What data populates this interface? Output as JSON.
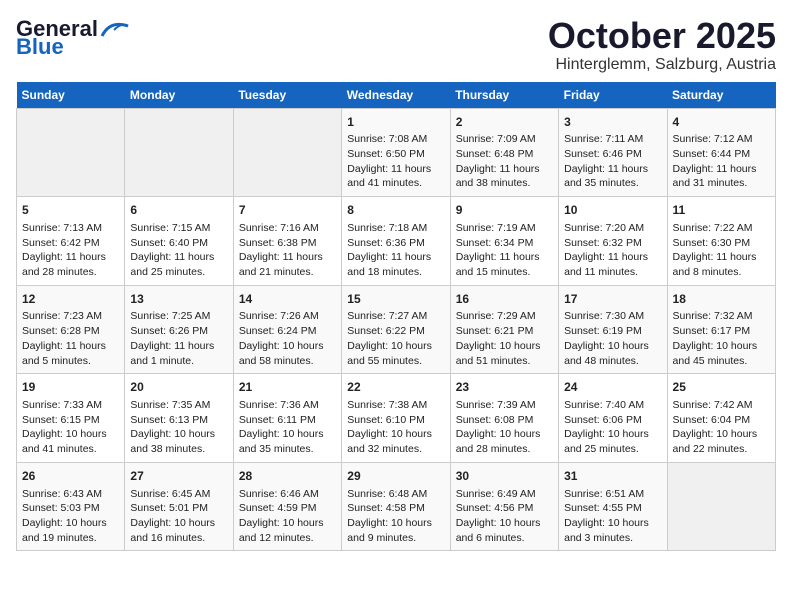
{
  "header": {
    "logo_general": "General",
    "logo_blue": "Blue",
    "month": "October 2025",
    "location": "Hinterglemm, Salzburg, Austria"
  },
  "weekdays": [
    "Sunday",
    "Monday",
    "Tuesday",
    "Wednesday",
    "Thursday",
    "Friday",
    "Saturday"
  ],
  "weeks": [
    [
      {
        "day": "",
        "info": ""
      },
      {
        "day": "",
        "info": ""
      },
      {
        "day": "",
        "info": ""
      },
      {
        "day": "1",
        "info": "Sunrise: 7:08 AM\nSunset: 6:50 PM\nDaylight: 11 hours\nand 41 minutes."
      },
      {
        "day": "2",
        "info": "Sunrise: 7:09 AM\nSunset: 6:48 PM\nDaylight: 11 hours\nand 38 minutes."
      },
      {
        "day": "3",
        "info": "Sunrise: 7:11 AM\nSunset: 6:46 PM\nDaylight: 11 hours\nand 35 minutes."
      },
      {
        "day": "4",
        "info": "Sunrise: 7:12 AM\nSunset: 6:44 PM\nDaylight: 11 hours\nand 31 minutes."
      }
    ],
    [
      {
        "day": "5",
        "info": "Sunrise: 7:13 AM\nSunset: 6:42 PM\nDaylight: 11 hours\nand 28 minutes."
      },
      {
        "day": "6",
        "info": "Sunrise: 7:15 AM\nSunset: 6:40 PM\nDaylight: 11 hours\nand 25 minutes."
      },
      {
        "day": "7",
        "info": "Sunrise: 7:16 AM\nSunset: 6:38 PM\nDaylight: 11 hours\nand 21 minutes."
      },
      {
        "day": "8",
        "info": "Sunrise: 7:18 AM\nSunset: 6:36 PM\nDaylight: 11 hours\nand 18 minutes."
      },
      {
        "day": "9",
        "info": "Sunrise: 7:19 AM\nSunset: 6:34 PM\nDaylight: 11 hours\nand 15 minutes."
      },
      {
        "day": "10",
        "info": "Sunrise: 7:20 AM\nSunset: 6:32 PM\nDaylight: 11 hours\nand 11 minutes."
      },
      {
        "day": "11",
        "info": "Sunrise: 7:22 AM\nSunset: 6:30 PM\nDaylight: 11 hours\nand 8 minutes."
      }
    ],
    [
      {
        "day": "12",
        "info": "Sunrise: 7:23 AM\nSunset: 6:28 PM\nDaylight: 11 hours\nand 5 minutes."
      },
      {
        "day": "13",
        "info": "Sunrise: 7:25 AM\nSunset: 6:26 PM\nDaylight: 11 hours\nand 1 minute."
      },
      {
        "day": "14",
        "info": "Sunrise: 7:26 AM\nSunset: 6:24 PM\nDaylight: 10 hours\nand 58 minutes."
      },
      {
        "day": "15",
        "info": "Sunrise: 7:27 AM\nSunset: 6:22 PM\nDaylight: 10 hours\nand 55 minutes."
      },
      {
        "day": "16",
        "info": "Sunrise: 7:29 AM\nSunset: 6:21 PM\nDaylight: 10 hours\nand 51 minutes."
      },
      {
        "day": "17",
        "info": "Sunrise: 7:30 AM\nSunset: 6:19 PM\nDaylight: 10 hours\nand 48 minutes."
      },
      {
        "day": "18",
        "info": "Sunrise: 7:32 AM\nSunset: 6:17 PM\nDaylight: 10 hours\nand 45 minutes."
      }
    ],
    [
      {
        "day": "19",
        "info": "Sunrise: 7:33 AM\nSunset: 6:15 PM\nDaylight: 10 hours\nand 41 minutes."
      },
      {
        "day": "20",
        "info": "Sunrise: 7:35 AM\nSunset: 6:13 PM\nDaylight: 10 hours\nand 38 minutes."
      },
      {
        "day": "21",
        "info": "Sunrise: 7:36 AM\nSunset: 6:11 PM\nDaylight: 10 hours\nand 35 minutes."
      },
      {
        "day": "22",
        "info": "Sunrise: 7:38 AM\nSunset: 6:10 PM\nDaylight: 10 hours\nand 32 minutes."
      },
      {
        "day": "23",
        "info": "Sunrise: 7:39 AM\nSunset: 6:08 PM\nDaylight: 10 hours\nand 28 minutes."
      },
      {
        "day": "24",
        "info": "Sunrise: 7:40 AM\nSunset: 6:06 PM\nDaylight: 10 hours\nand 25 minutes."
      },
      {
        "day": "25",
        "info": "Sunrise: 7:42 AM\nSunset: 6:04 PM\nDaylight: 10 hours\nand 22 minutes."
      }
    ],
    [
      {
        "day": "26",
        "info": "Sunrise: 6:43 AM\nSunset: 5:03 PM\nDaylight: 10 hours\nand 19 minutes."
      },
      {
        "day": "27",
        "info": "Sunrise: 6:45 AM\nSunset: 5:01 PM\nDaylight: 10 hours\nand 16 minutes."
      },
      {
        "day": "28",
        "info": "Sunrise: 6:46 AM\nSunset: 4:59 PM\nDaylight: 10 hours\nand 12 minutes."
      },
      {
        "day": "29",
        "info": "Sunrise: 6:48 AM\nSunset: 4:58 PM\nDaylight: 10 hours\nand 9 minutes."
      },
      {
        "day": "30",
        "info": "Sunrise: 6:49 AM\nSunset: 4:56 PM\nDaylight: 10 hours\nand 6 minutes."
      },
      {
        "day": "31",
        "info": "Sunrise: 6:51 AM\nSunset: 4:55 PM\nDaylight: 10 hours\nand 3 minutes."
      },
      {
        "day": "",
        "info": ""
      }
    ]
  ]
}
